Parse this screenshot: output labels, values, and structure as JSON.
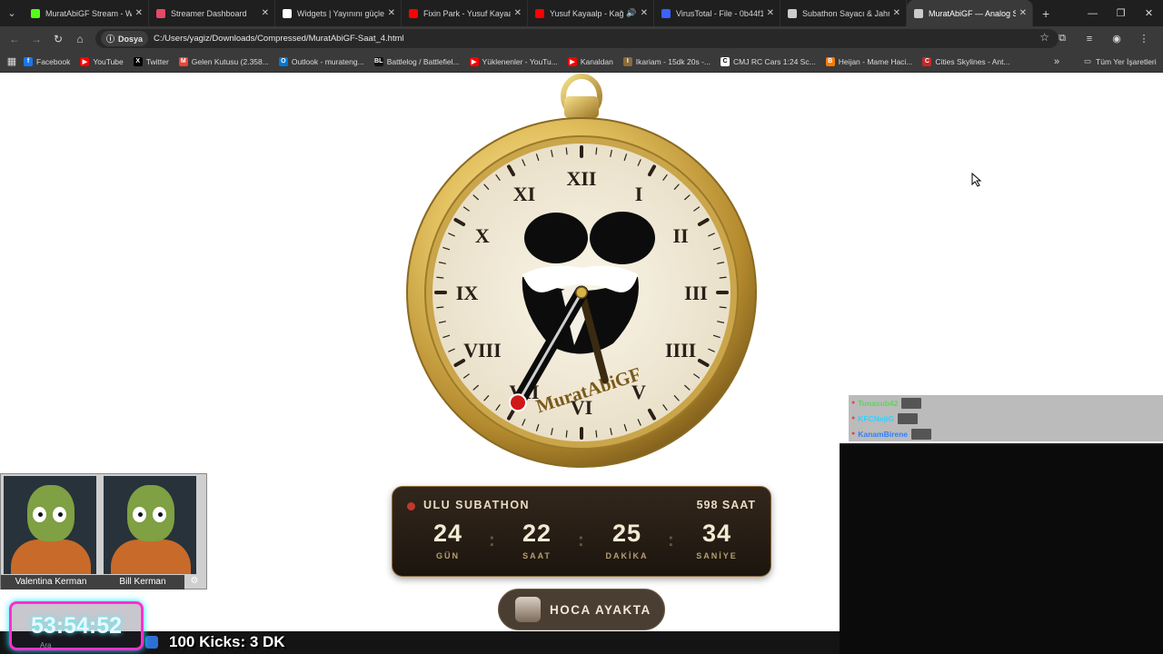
{
  "browser": {
    "tabs": [
      {
        "label": "MuratAbiGF Stream - Wat",
        "icon": "kick-icon",
        "color": "#53fc18",
        "active": false
      },
      {
        "label": "Streamer Dashboard",
        "icon": "dashboard-icon",
        "color": "#e24a6a",
        "active": false
      },
      {
        "label": "Widgets | Yayınını güçlen",
        "icon": "widgets-icon",
        "color": "#ffffff",
        "active": false
      },
      {
        "label": "Fixin Park - Yusuf Kayaalp",
        "icon": "youtube-icon",
        "color": "#ff0000",
        "active": false
      },
      {
        "label": "Yusuf Kayaalp - Kağıt",
        "icon": "youtube-icon",
        "color": "#ff0000",
        "active": false,
        "audio": true
      },
      {
        "label": "VirusTotal - File - 0b44f1",
        "icon": "virustotal-icon",
        "color": "#3b61ff",
        "active": false
      },
      {
        "label": "Subathon Sayacı & Jahre",
        "icon": "globe-icon",
        "color": "#cccccc",
        "active": false
      },
      {
        "label": "MuratAbiGF — Analog Sa",
        "icon": "globe-icon",
        "color": "#cccccc",
        "active": true
      }
    ],
    "address": {
      "chip": "Dosya",
      "url": "C:/Users/yagiz/Downloads/Compressed/MuratAbiGF-Saat_4.html"
    },
    "bookmarks": [
      {
        "label": "Facebook",
        "color": "#1877f2",
        "glyph": "f"
      },
      {
        "label": "YouTube",
        "color": "#ff0000",
        "glyph": "▶"
      },
      {
        "label": "Twitter",
        "color": "#000000",
        "glyph": "X"
      },
      {
        "label": "Gelen Kutusu (2.358...",
        "color": "#ea4335",
        "glyph": "M"
      },
      {
        "label": "Outlook - murateng...",
        "color": "#0078d4",
        "glyph": "O"
      },
      {
        "label": "Battlelog / Battlefiel...",
        "color": "#111111",
        "glyph": "BL"
      },
      {
        "label": "Yüklenenler - YouTu...",
        "color": "#ff0000",
        "glyph": "▶"
      },
      {
        "label": "Kanaldan",
        "color": "#ff0000",
        "glyph": "▶"
      },
      {
        "label": "Ikariam - 15dk 20s -...",
        "color": "#8a6a3a",
        "glyph": "I"
      },
      {
        "label": "CMJ RC Cars 1:24 Sc...",
        "color": "#ffffff",
        "glyph": "C"
      },
      {
        "label": "Heijan - Mame Haci...",
        "color": "#f57c00",
        "glyph": "B"
      },
      {
        "label": "Cities Skylines - Ant...",
        "color": "#c62828",
        "glyph": "C"
      }
    ],
    "all_bookmarks": "Tüm Yer İşaretleri"
  },
  "clock": {
    "numerals": [
      "XII",
      "I",
      "II",
      "III",
      "IIII",
      "V",
      "VI",
      "VII",
      "VIII",
      "IX",
      "X",
      "XI"
    ],
    "brand_text": "MuratAbiGF",
    "hour_hand_angle_deg": 210,
    "minute_hand_angle_deg": 165
  },
  "subathon": {
    "title": "ULU SUBATHON",
    "total": "598 SAAT",
    "units": [
      {
        "value": "24",
        "label": "GÜN"
      },
      {
        "value": "22",
        "label": "SAAT"
      },
      {
        "value": "25",
        "label": "DAKİKA"
      },
      {
        "value": "34",
        "label": "SANİYE"
      }
    ],
    "separator": ":"
  },
  "status_button": {
    "label": "HOCA AYAKTA"
  },
  "chat": [
    {
      "user": "Tunasub42",
      "color": "#5fd35f"
    },
    {
      "user": "KFCNejiG",
      "color": "#35d0ff"
    },
    {
      "user": "KanamBirene",
      "color": "#2f7fff"
    }
  ],
  "cams": [
    {
      "name": "Valentina Kerman"
    },
    {
      "name": "Bill Kerman"
    }
  ],
  "overlay": {
    "timer": "53:54:52",
    "kicks_text": "100 Kicks: 3 DK",
    "search": "Ara"
  }
}
